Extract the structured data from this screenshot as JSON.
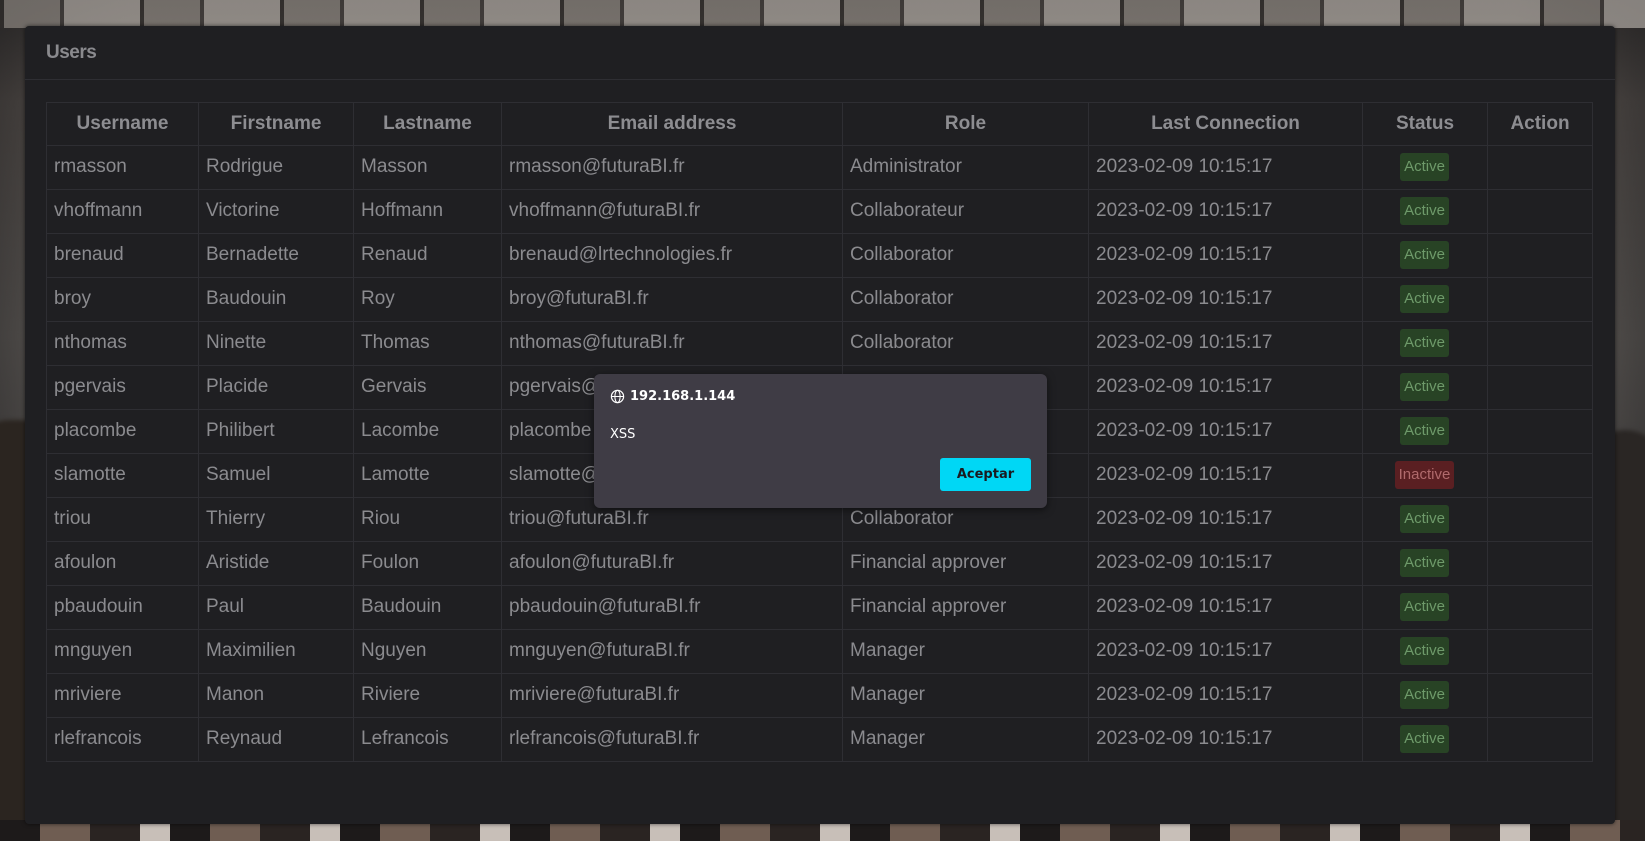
{
  "panel": {
    "title": "Users"
  },
  "table": {
    "headers": [
      "Username",
      "Firstname",
      "Lastname",
      "Email address",
      "Role",
      "Last Connection",
      "Status",
      "Action"
    ],
    "rows": [
      {
        "username": "rmasson",
        "firstname": "Rodrigue",
        "lastname": "Masson",
        "email": "rmasson@futuraBI.fr",
        "role": "Administrator",
        "last_connection": "2023-02-09 10:15:17",
        "status": "Active"
      },
      {
        "username": "vhoffmann",
        "firstname": "Victorine",
        "lastname": "Hoffmann",
        "email": "vhoffmann@futuraBI.fr",
        "role": "Collaborateur",
        "last_connection": "2023-02-09 10:15:17",
        "status": "Active"
      },
      {
        "username": "brenaud",
        "firstname": "Bernadette",
        "lastname": "Renaud",
        "email": "brenaud@lrtechnologies.fr",
        "role": "Collaborator",
        "last_connection": "2023-02-09 10:15:17",
        "status": "Active"
      },
      {
        "username": "broy",
        "firstname": "Baudouin",
        "lastname": "Roy",
        "email": "broy@futuraBI.fr",
        "role": "Collaborator",
        "last_connection": "2023-02-09 10:15:17",
        "status": "Active"
      },
      {
        "username": "nthomas",
        "firstname": "Ninette",
        "lastname": "Thomas",
        "email": "nthomas@futuraBI.fr",
        "role": "Collaborator",
        "last_connection": "2023-02-09 10:15:17",
        "status": "Active"
      },
      {
        "username": "pgervais",
        "firstname": "Placide",
        "lastname": "Gervais",
        "email": "pgervais@",
        "role": "",
        "last_connection": "2023-02-09 10:15:17",
        "status": "Active"
      },
      {
        "username": "placombe",
        "firstname": "Philibert",
        "lastname": "Lacombe",
        "email": "placombe",
        "role": "",
        "last_connection": "2023-02-09 10:15:17",
        "status": "Active"
      },
      {
        "username": "slamotte",
        "firstname": "Samuel",
        "lastname": "Lamotte",
        "email": "slamotte@",
        "role": "",
        "last_connection": "2023-02-09 10:15:17",
        "status": "Inactive"
      },
      {
        "username": "triou",
        "firstname": "Thierry",
        "lastname": "Riou",
        "email": "triou@futuraBI.fr",
        "role": "Collaborator",
        "last_connection": "2023-02-09 10:15:17",
        "status": "Active"
      },
      {
        "username": "afoulon",
        "firstname": "Aristide",
        "lastname": "Foulon",
        "email": "afoulon@futuraBI.fr",
        "role": "Financial approver",
        "last_connection": "2023-02-09 10:15:17",
        "status": "Active"
      },
      {
        "username": "pbaudouin",
        "firstname": "Paul",
        "lastname": "Baudouin",
        "email": "pbaudouin@futuraBI.fr",
        "role": "Financial approver",
        "last_connection": "2023-02-09 10:15:17",
        "status": "Active"
      },
      {
        "username": "mnguyen",
        "firstname": "Maximilien",
        "lastname": "Nguyen",
        "email": "mnguyen@futuraBI.fr",
        "role": "Manager",
        "last_connection": "2023-02-09 10:15:17",
        "status": "Active"
      },
      {
        "username": "mriviere",
        "firstname": "Manon",
        "lastname": "Riviere",
        "email": "mriviere@futuraBI.fr",
        "role": "Manager",
        "last_connection": "2023-02-09 10:15:17",
        "status": "Active"
      },
      {
        "username": "rlefrancois",
        "firstname": "Reynaud",
        "lastname": "Lefrancois",
        "email": "rlefrancois@futuraBI.fr",
        "role": "Manager",
        "last_connection": "2023-02-09 10:15:17",
        "status": "Active"
      }
    ]
  },
  "dialog": {
    "origin": "192.168.1.144",
    "origin_icon": "globe-icon",
    "message": "XSS",
    "button_label": "Aceptar"
  },
  "colors": {
    "panel_bg": "#1f1f22",
    "active_badge_bg": "#284325",
    "inactive_badge_bg": "#5a1f22",
    "dialog_bg": "#3f3c45",
    "dialog_button": "#00d7f5"
  }
}
